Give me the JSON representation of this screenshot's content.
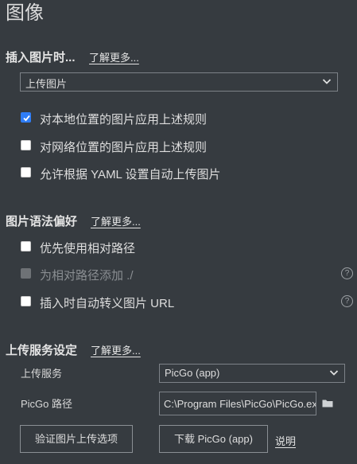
{
  "page": {
    "title": "图像"
  },
  "insert_section": {
    "title": "插入图片时...",
    "learn_more": "了解更多...",
    "dropdown": {
      "value": "上传图片"
    },
    "options": [
      {
        "label": "对本地位置的图片应用上述规则",
        "checked": true
      },
      {
        "label": "对网络位置的图片应用上述规则",
        "checked": false
      },
      {
        "label": "允许根据 YAML 设置自动上传图片",
        "checked": false
      }
    ]
  },
  "syntax_section": {
    "title": "图片语法偏好",
    "learn_more": "了解更多...",
    "options": [
      {
        "label": "优先使用相对路径",
        "checked": false,
        "disabled": false
      },
      {
        "label": "为相对路径添加 ./",
        "checked": false,
        "disabled": true
      },
      {
        "label": "插入时自动转义图片 URL",
        "checked": false,
        "disabled": false
      }
    ],
    "help_glyph": "?"
  },
  "upload_section": {
    "title": "上传服务设定",
    "learn_more": "了解更多...",
    "service_label": "上传服务",
    "service_value": "PicGo (app)",
    "path_label": "PicGo 路径",
    "path_value": "C:\\Program Files\\PicGo\\PicGo.exe",
    "verify_button": "验证图片上传选项",
    "download_button": "下载 PicGo (app)",
    "explain_link": "说明"
  },
  "colors": {
    "background": "#363b40",
    "checkbox_checked": "#2f7df6",
    "text": "#dedede"
  },
  "icons": {
    "dropdown": "chevron-down-icon",
    "folder": "folder-icon",
    "help": "help-circle-icon",
    "check": "check-icon"
  }
}
